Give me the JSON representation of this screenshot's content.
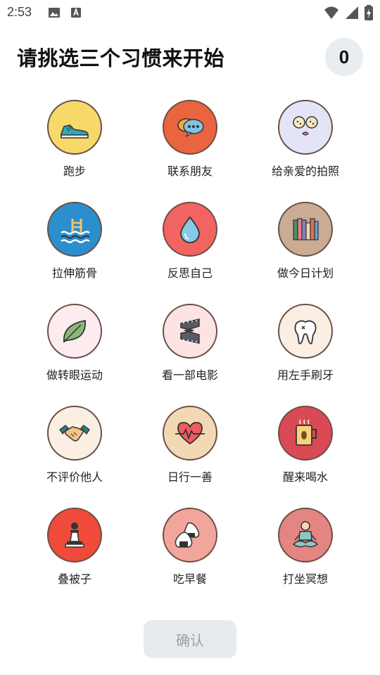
{
  "status_bar": {
    "time": "2:53",
    "icons": [
      "image-icon",
      "font-download-icon",
      "wifi-icon",
      "cellular-signal-icon",
      "battery-charging-icon"
    ]
  },
  "header": {
    "title": "请挑选三个习惯来开始",
    "selected_count": "0"
  },
  "habits": [
    {
      "label": "跑步",
      "icon": "running-shoe-icon",
      "color": "#f6d86b"
    },
    {
      "label": "联系朋友",
      "icon": "chat-bubbles-icon",
      "color": "#e9643f"
    },
    {
      "label": "给亲爱的拍照",
      "icon": "cute-face-icon",
      "color": "#e3e4f7"
    },
    {
      "label": "拉伸筋骨",
      "icon": "swimming-pool-icon",
      "color": "#2b8fce"
    },
    {
      "label": "反思自己",
      "icon": "water-drop-icon",
      "color": "#f26461"
    },
    {
      "label": "做今日计划",
      "icon": "books-icon",
      "color": "#c9ac93"
    },
    {
      "label": "做转眼运动",
      "icon": "leaf-icon",
      "color": "#fdecef"
    },
    {
      "label": "看一部电影",
      "icon": "film-strip-icon",
      "color": "#fde3e4"
    },
    {
      "label": "用左手刷牙",
      "icon": "tooth-icon",
      "color": "#fbefe3"
    },
    {
      "label": "不评价他人",
      "icon": "handshake-icon",
      "color": "#fbefe3"
    },
    {
      "label": "日行一善",
      "icon": "heartbeat-icon",
      "color": "#f3d9b3"
    },
    {
      "label": "醒来喝水",
      "icon": "coffee-mug-icon",
      "color": "#d94a55"
    },
    {
      "label": "叠被子",
      "icon": "chess-pawn-icon",
      "color": "#ef4a3a"
    },
    {
      "label": "吃早餐",
      "icon": "rice-ball-icon",
      "color": "#f2a59b"
    },
    {
      "label": "打坐冥想",
      "icon": "meditation-icon",
      "color": "#e28583"
    }
  ],
  "confirm_button": {
    "label": "确认"
  }
}
